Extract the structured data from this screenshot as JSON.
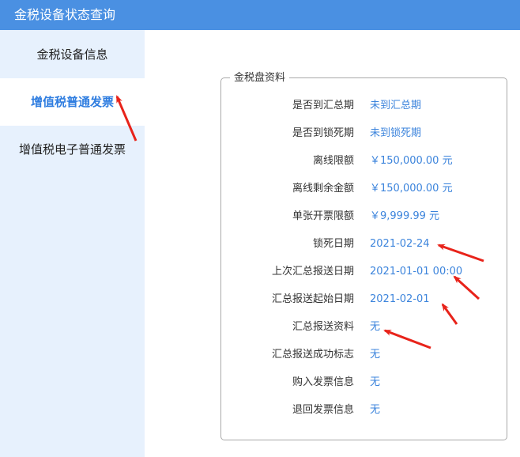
{
  "window": {
    "title": "金税设备状态查询"
  },
  "sidebar": {
    "items": [
      {
        "label": "金税设备信息"
      },
      {
        "label": "增值税普通发票"
      },
      {
        "label": "增值税电子普通发票"
      }
    ],
    "active_index": 1
  },
  "panel": {
    "legend": "金税盘资料",
    "rows": [
      {
        "label": "是否到汇总期",
        "value": "未到汇总期"
      },
      {
        "label": "是否到锁死期",
        "value": "未到锁死期"
      },
      {
        "label": "离线限额",
        "value": "￥150,000.00 元"
      },
      {
        "label": "离线剩余金额",
        "value": "￥150,000.00 元"
      },
      {
        "label": "单张开票限额",
        "value": "￥9,999.99 元"
      },
      {
        "label": "锁死日期",
        "value": "2021-02-24"
      },
      {
        "label": "上次汇总报送日期",
        "value": "2021-01-01 00:00"
      },
      {
        "label": "汇总报送起始日期",
        "value": "2021-02-01"
      },
      {
        "label": "汇总报送资料",
        "value": "无"
      },
      {
        "label": "汇总报送成功标志",
        "value": "无"
      },
      {
        "label": "购入发票信息",
        "value": "无"
      },
      {
        "label": "退回发票信息",
        "value": "无"
      }
    ]
  },
  "colors": {
    "titlebar": "#4a90e2",
    "sidebar": "#e7f1fd",
    "active_text": "#2f7de0",
    "value_text": "#3c84dc",
    "annotation_arrow": "#e8231a"
  }
}
